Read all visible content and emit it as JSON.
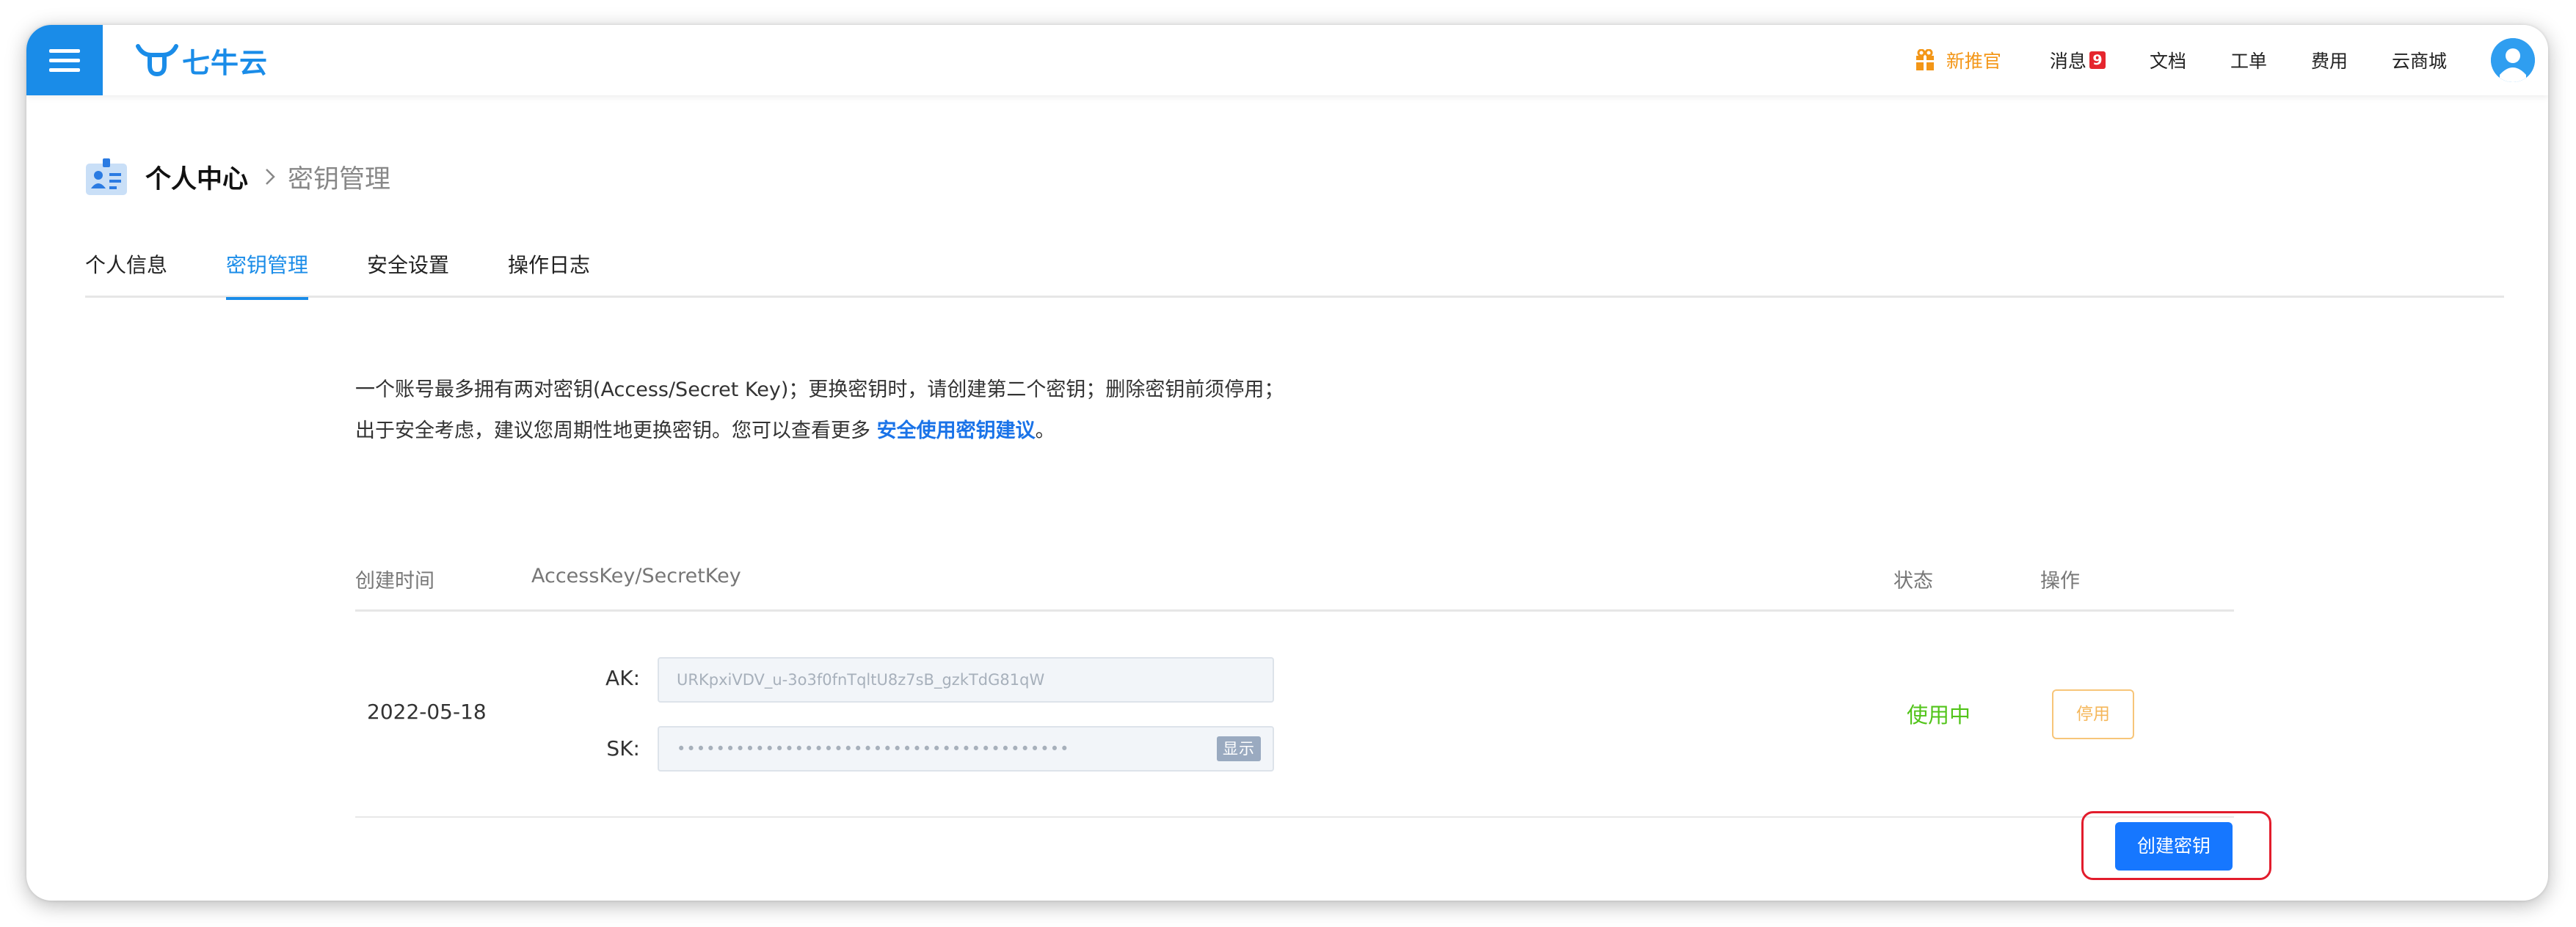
{
  "brand": {
    "name": "七牛云",
    "color": "#1a8ce8"
  },
  "header": {
    "promo": "新推官",
    "messages": "消息",
    "message_count": "9",
    "docs": "文档",
    "tickets": "工单",
    "billing": "费用",
    "marketplace": "云商城"
  },
  "breadcrumb": {
    "parent": "个人中心",
    "current": "密钥管理"
  },
  "tabs": [
    {
      "label": "个人信息"
    },
    {
      "label": "密钥管理",
      "active": true
    },
    {
      "label": "安全设置"
    },
    {
      "label": "操作日志"
    }
  ],
  "description": {
    "text": "一个账号最多拥有两对密钥(Access/Secret Key)；更换密钥时，请创建第二个密钥；删除密钥前须停用；出于安全考虑，建议您周期性地更换密钥。您可以查看更多 ",
    "link": "安全使用密钥建议",
    "suffix": "。"
  },
  "table": {
    "headers": {
      "created": "创建时间",
      "keys": "AccessKey/SecretKey",
      "status": "状态",
      "actions": "操作"
    },
    "rows": [
      {
        "created": "2022-05-18",
        "ak_label": "AK:",
        "ak_value": "URKpxiVDV_u-3o3f0fnTqltU8z7sB_gzkTdG81qW",
        "sk_label": "SK:",
        "sk_value": "••••••••••••••••••••••••••••••••••••••••",
        "show_label": "显示",
        "status": "使用中",
        "disable_label": "停用"
      }
    ]
  },
  "create_button": "创建密钥",
  "colors": {
    "accent": "#1a8ce8",
    "link": "#1a73e8",
    "status_active": "#52c41a",
    "warning": "#f5b75b",
    "highlight": "#e21c2c",
    "primary_button": "#1677ff"
  }
}
